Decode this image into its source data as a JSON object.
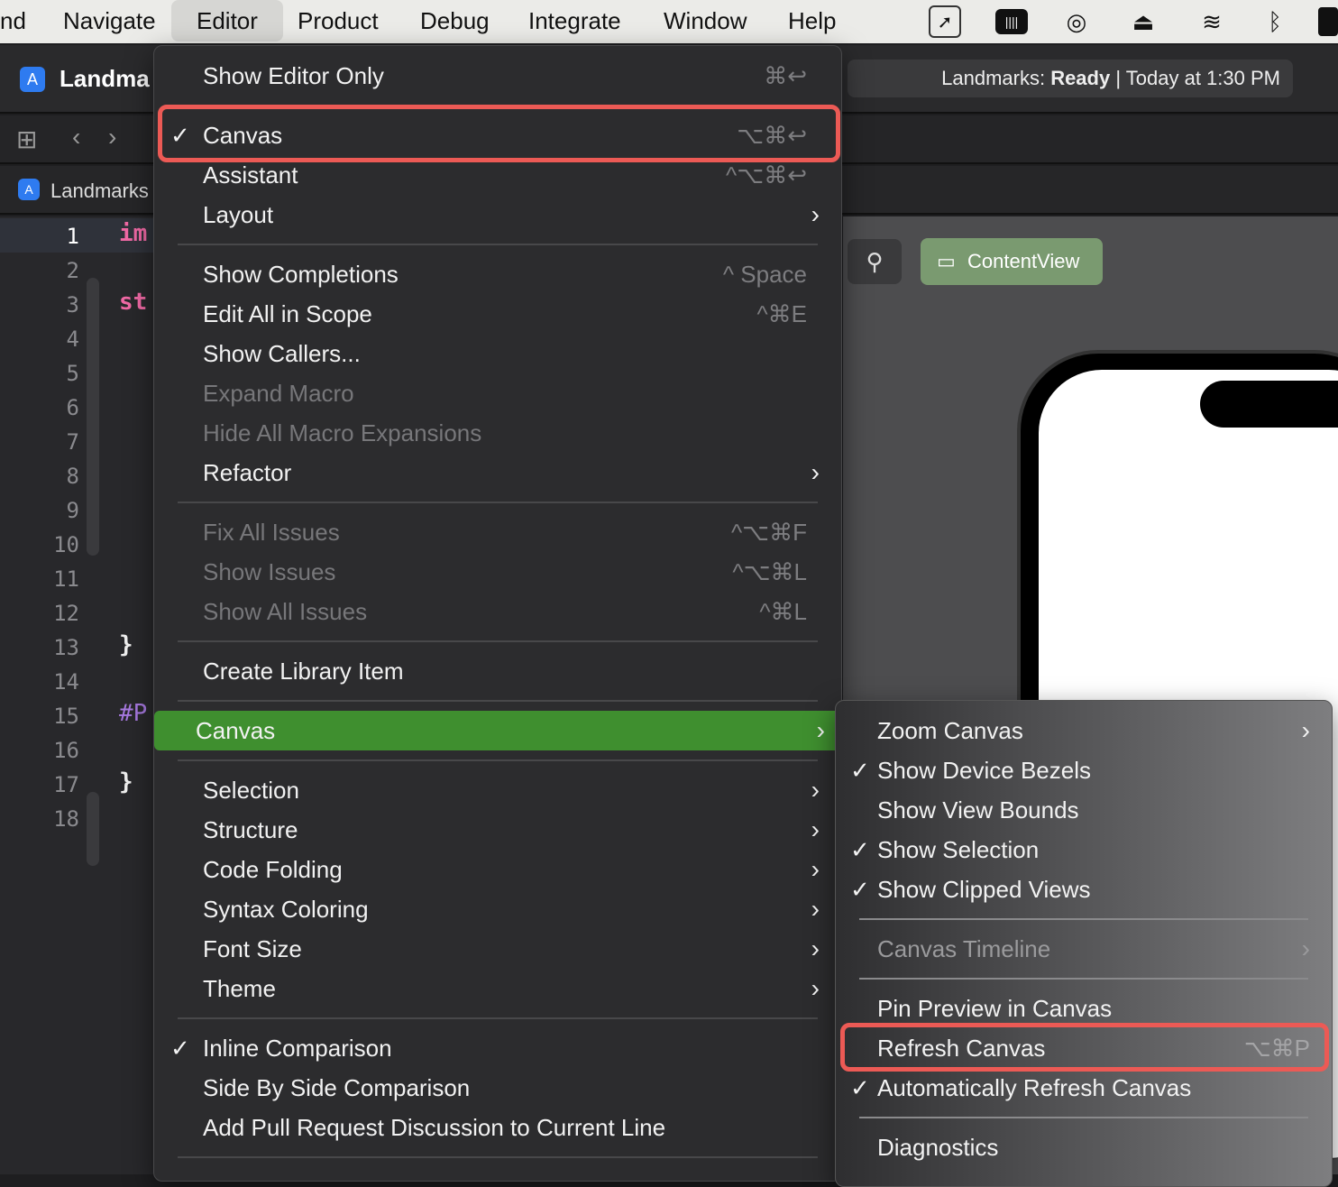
{
  "menubar": {
    "items": [
      "nd",
      "Navigate",
      "Editor",
      "Product",
      "Debug",
      "Integrate",
      "Window",
      "Help"
    ]
  },
  "tray": {
    "icons": [
      "pointer-icon",
      "battery-keyboard-icon",
      "airdrop-icon",
      "eject-icon",
      "wifi-icon",
      "bluetooth-icon"
    ]
  },
  "toolbar": {
    "project": "Landma",
    "status_prefix": "Landmarks: ",
    "status_bold": "Ready",
    "status_suffix": " | Today at 1:30 PM"
  },
  "tab": {
    "label": "Landmarks"
  },
  "editor": {
    "line_numbers": [
      "1",
      "2",
      "3",
      "4",
      "5",
      "6",
      "7",
      "8",
      "9",
      "10",
      "11",
      "12",
      "13",
      "14",
      "15",
      "16",
      "17",
      "18"
    ],
    "code": {
      "l1": "im",
      "l3": "st",
      "l13": "}",
      "l15": "#P",
      "l17": "}"
    }
  },
  "canvas": {
    "preview_button": "ContentView",
    "pin": "pin-icon"
  },
  "menu": {
    "show_editor_only": {
      "label": "Show Editor Only",
      "shortcut": "⌘↩"
    },
    "canvas": {
      "check": "✓",
      "label": "Canvas",
      "shortcut": "⌥⌘↩"
    },
    "assistant": {
      "label": "Assistant",
      "shortcut": "^⌥⌘↩"
    },
    "layout": {
      "label": "Layout"
    },
    "show_completions": {
      "label": "Show Completions",
      "shortcut": "^ Space"
    },
    "edit_all": {
      "label": "Edit All in Scope",
      "shortcut": "^⌘E"
    },
    "show_callers": {
      "label": "Show Callers..."
    },
    "expand_macro": {
      "label": "Expand Macro"
    },
    "hide_macro": {
      "label": "Hide All Macro Expansions"
    },
    "refactor": {
      "label": "Refactor"
    },
    "fix_all": {
      "label": "Fix All Issues",
      "shortcut": "^⌥⌘F"
    },
    "show_issues": {
      "label": "Show Issues",
      "shortcut": "^⌥⌘L"
    },
    "show_all_issues": {
      "label": "Show All Issues",
      "shortcut": "^⌘L"
    },
    "create_library": {
      "label": "Create Library Item"
    },
    "canvas_sub": {
      "label": "Canvas"
    },
    "selection": {
      "label": "Selection"
    },
    "structure": {
      "label": "Structure"
    },
    "code_folding": {
      "label": "Code Folding"
    },
    "syntax_coloring": {
      "label": "Syntax Coloring"
    },
    "font_size": {
      "label": "Font Size"
    },
    "theme": {
      "label": "Theme"
    },
    "inline_comparison": {
      "check": "✓",
      "label": "Inline Comparison"
    },
    "side_by_side": {
      "label": "Side By Side Comparison"
    },
    "add_pr": {
      "label": "Add Pull Request Discussion to Current Line"
    }
  },
  "submenu": {
    "zoom": {
      "label": "Zoom Canvas"
    },
    "bezels": {
      "check": "✓",
      "label": "Show Device Bezels"
    },
    "bounds": {
      "label": "Show View Bounds"
    },
    "selection": {
      "check": "✓",
      "label": "Show Selection"
    },
    "clipped": {
      "check": "✓",
      "label": "Show Clipped Views"
    },
    "timeline": {
      "label": "Canvas Timeline"
    },
    "pin": {
      "label": "Pin Preview in Canvas"
    },
    "refresh": {
      "label": "Refresh Canvas",
      "shortcut": "⌥⌘P"
    },
    "auto_refresh": {
      "check": "✓",
      "label": "Automatically Refresh Canvas"
    },
    "diagnostics": {
      "label": "Diagnostics"
    }
  },
  "colors": {
    "highlight": "#3f8f2f",
    "annotation": "#ec5a55",
    "keyword": "#f069a5",
    "preprocessor": "#a779e0"
  }
}
